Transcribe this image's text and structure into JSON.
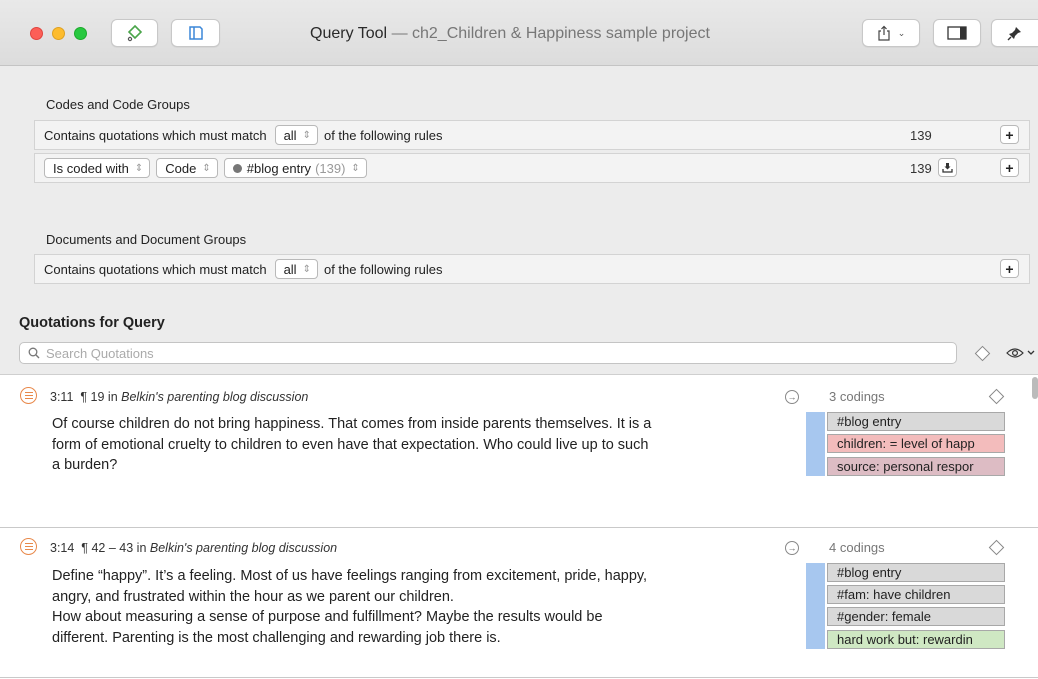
{
  "window": {
    "title": "Query Tool",
    "subtitle": "— ch2_Children & Happiness sample project"
  },
  "codes_section": {
    "label": "Codes and Code Groups",
    "rule_prefix": "Contains quotations which must match",
    "match_value": "all",
    "rule_suffix": "of the following rules",
    "count": "139",
    "condition": {
      "operator": "Is coded with",
      "type": "Code",
      "code": "#blog entry",
      "code_count": "(139)",
      "count": "139"
    }
  },
  "documents_section": {
    "label": "Documents and Document Groups",
    "rule_prefix": "Contains quotations which must match",
    "match_value": "all",
    "rule_suffix": "of the following rules"
  },
  "quotations": {
    "header": "Quotations for Query",
    "search_placeholder": "Search Quotations",
    "items": [
      {
        "id": "3:11",
        "paragraph": "¶ 19 in",
        "document": "Belkin's parenting blog discussion",
        "lines": [
          "Of course children do not bring happiness. That comes from inside parents themselves. It is a",
          "form of emotional cruelty to children to even have that expectation. Who could live up to such",
          "a burden?"
        ],
        "codings_label": "3 codings",
        "codes": [
          {
            "label": "#blog entry",
            "color": "#d9d9d9"
          },
          {
            "label": "children: = level of happ",
            "color": "#f3bcbc"
          },
          {
            "label": "source: personal respor",
            "color": "#ddbcc4"
          }
        ]
      },
      {
        "id": "3:14",
        "paragraph": "¶ 42 – 43 in",
        "document": "Belkin's parenting blog discussion",
        "lines": [
          "Define “happy”. It’s a feeling. Most of us have feelings ranging from excitement, pride, happy,",
          "angry, and frustrated within the hour as we parent our children.",
          "How about measuring a sense of purpose and fulfillment? Maybe the results would be",
          "different. Parenting is the most challenging and rewarding job there is."
        ],
        "codings_label": "4 codings",
        "codes": [
          {
            "label": "#blog entry",
            "color": "#d9d9d9"
          },
          {
            "label": "#fam: have children",
            "color": "#d9d9d9"
          },
          {
            "label": "#gender: female",
            "color": "#d9d9d9"
          },
          {
            "label": "hard work but: rewardin",
            "color": "#cfe8c3"
          }
        ]
      }
    ]
  },
  "icons": {
    "code_tool": "diamond-pen-icon",
    "sidebar": "sidebar-toggle-icon",
    "share": "share-icon",
    "inspector": "inspector-panel-icon",
    "pin": "pin-icon",
    "search": "magnifier-icon",
    "eye": "eye-icon"
  }
}
